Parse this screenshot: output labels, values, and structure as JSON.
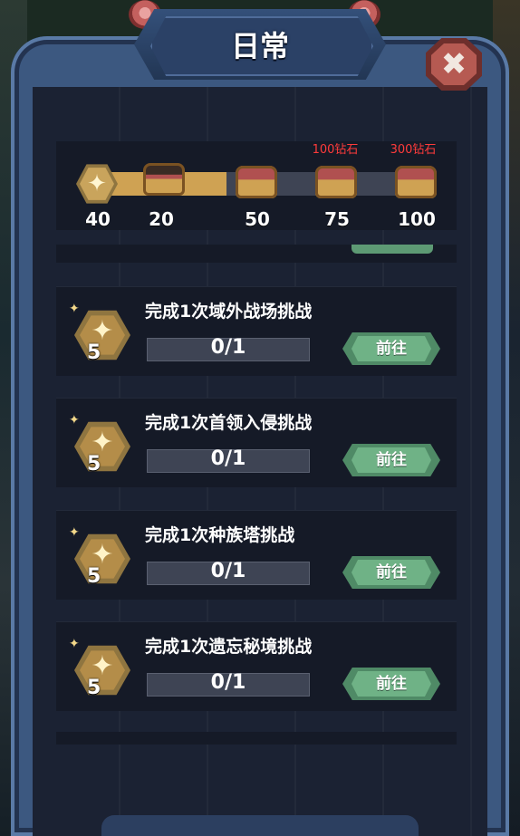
{
  "window": {
    "title": "日常"
  },
  "colors": {
    "accent_gold": "#cfa253",
    "go_green": "#6fb286",
    "reward_red": "#ff3b3b",
    "panel_bg": "#1b2233"
  },
  "close_icon": "close-x-icon",
  "activity": {
    "current_points": "40",
    "progress_fraction": 0.4,
    "milestones": [
      {
        "points": "20",
        "reward_text": "",
        "opened": true
      },
      {
        "points": "50",
        "reward_text": "",
        "opened": false
      },
      {
        "points": "75",
        "reward_text": "100钻石",
        "opened": false
      },
      {
        "points": "100",
        "reward_text": "300钻石",
        "opened": false
      }
    ]
  },
  "tasks": [
    {
      "title": "完成1次域外战场挑战",
      "points": "5",
      "progress": "0/1",
      "button": "前往"
    },
    {
      "title": "完成1次首领入侵挑战",
      "points": "5",
      "progress": "0/1",
      "button": "前往"
    },
    {
      "title": "完成1次种族塔挑战",
      "points": "5",
      "progress": "0/1",
      "button": "前往"
    },
    {
      "title": "完成1次遗忘秘境挑战",
      "points": "5",
      "progress": "0/1",
      "button": "前往"
    }
  ]
}
